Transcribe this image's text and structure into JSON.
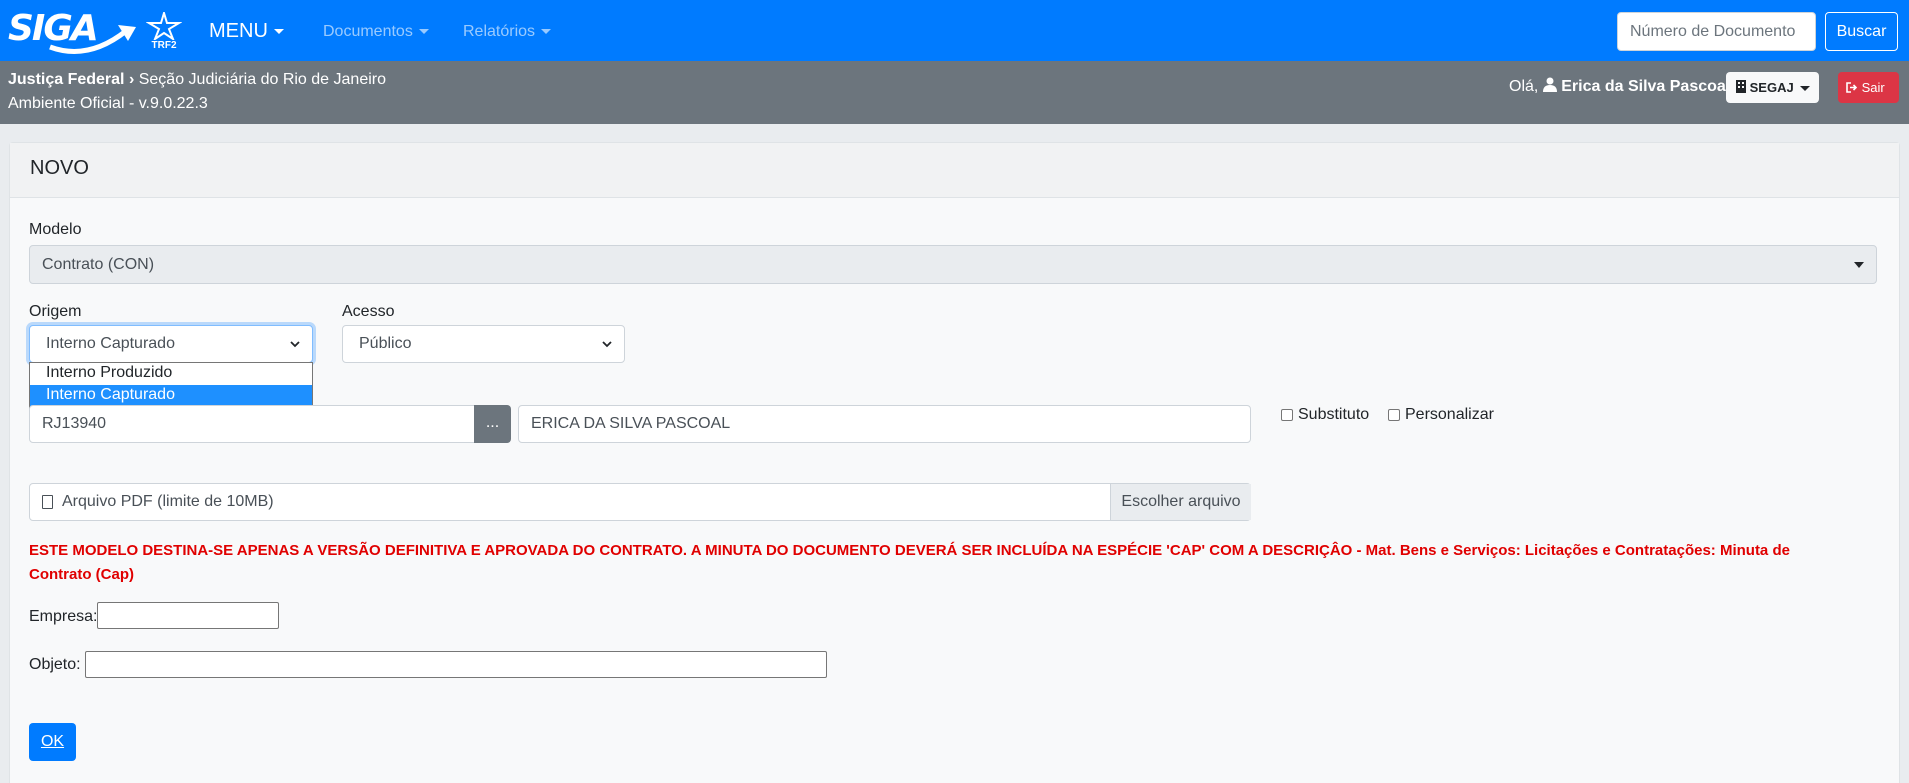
{
  "navbar": {
    "logo_text": "SIGA",
    "org_logo_text": "TRF2",
    "menu_label": "MENU",
    "links": [
      "Documentos",
      "Relatórios"
    ],
    "search_placeholder": "Número de Documento",
    "search_button": "Buscar"
  },
  "header": {
    "breadcrumb_org": "Justiça Federal",
    "breadcrumb_section": "Seção Judiciária do Rio de Janeiro",
    "environment": "Ambiente Oficial - v.9.0.22.3",
    "greeting": "Olá,",
    "user_name": "Erica da Silva Pascoal",
    "lotacao": "SEGAJ",
    "logout": "Sair"
  },
  "form": {
    "title": "NOVO",
    "modelo_label": "Modelo",
    "modelo_value": "Contrato (CON)",
    "origem_label": "Origem",
    "origem_value": "Interno Capturado",
    "origem_options": [
      "Interno Produzido",
      "Interno Capturado"
    ],
    "acesso_label": "Acesso",
    "acesso_value": "Público",
    "subscritor_matricula": "RJ13940",
    "subscritor_button": "...",
    "subscritor_nome": "ERICA DA SILVA PASCOAL",
    "substituto_label": "Substituto",
    "personalizar_label": "Personalizar",
    "arquivo_label": "Arquivo PDF (limite de 10MB)",
    "arquivo_button": "Escolher arquivo",
    "warning": "ESTE MODELO DESTINA-SE APENAS A VERSÃO DEFINITIVA E APROVADA DO CONTRATO. A MINUTA DO DOCUMENTO DEVERÁ SER INCLUÍDA NA ESPÉCIE 'CAP' COM A DESCRIÇÂO - Mat. Bens e Serviços: Licitações e Contratações: Minuta de Contrato (Cap)",
    "empresa_label": "Empresa:",
    "empresa_value": "",
    "objeto_label": "Objeto:",
    "objeto_value": "",
    "ok_button": "OK"
  },
  "colors": {
    "navbar": "#007bff",
    "subbar": "#6c757d",
    "warning": "#e00000",
    "danger": "#dc3545"
  }
}
